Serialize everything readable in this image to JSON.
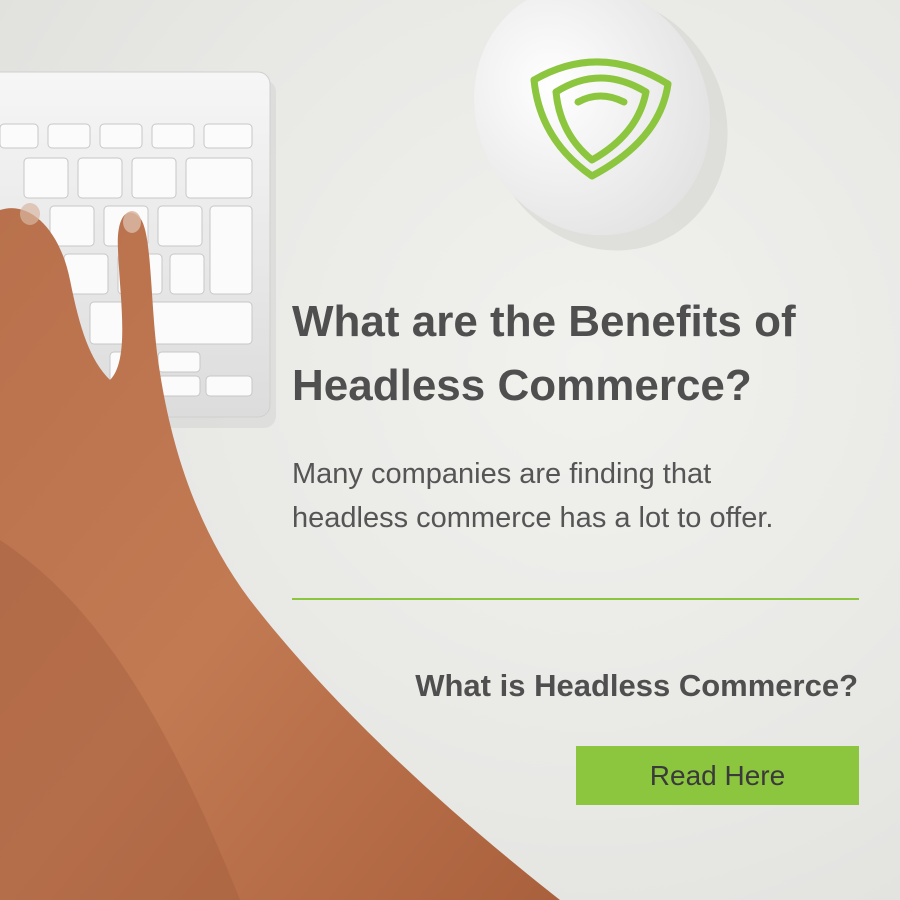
{
  "hero": {
    "headline_line1": "What are the Benefits of",
    "headline_line2": "Headless Commerce?",
    "subtext_line1": "Many companies are finding that",
    "subtext_line2": "headless commerce has a lot to offer."
  },
  "section": {
    "heading": "What is Headless Commerce?"
  },
  "cta": {
    "label": "Read Here"
  },
  "colors": {
    "accent": "#8cc63f",
    "text": "#4f4f4f",
    "background": "#e9e9e6"
  },
  "icons": [
    "shield-logo-icon"
  ]
}
